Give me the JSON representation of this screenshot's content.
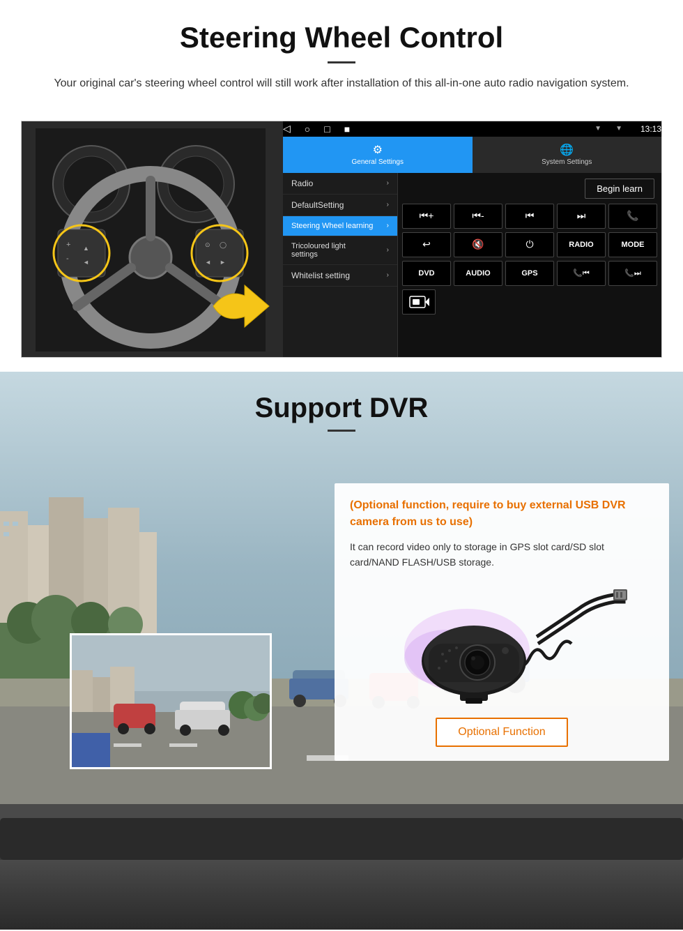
{
  "header": {
    "title": "Steering Wheel Control",
    "subtitle": "Your original car's steering wheel control will still work after installation of this all-in-one auto radio navigation system."
  },
  "android_ui": {
    "statusbar": {
      "time": "13:13",
      "icons": [
        "signal",
        "wifi",
        "battery"
      ]
    },
    "nav_icons": [
      "◁",
      "○",
      "□",
      "■"
    ],
    "tabs": [
      {
        "icon": "⚙",
        "label": "General Settings",
        "active": true
      },
      {
        "icon": "🌐",
        "label": "System Settings",
        "active": false
      }
    ],
    "menu_items": [
      {
        "label": "Radio",
        "active": false
      },
      {
        "label": "DefaultSetting",
        "active": false
      },
      {
        "label": "Steering Wheel learning",
        "active": true
      },
      {
        "label": "Tricoloured light settings",
        "active": false
      },
      {
        "label": "Whitelist setting",
        "active": false
      }
    ],
    "begin_learn_label": "Begin learn",
    "control_buttons_row1": [
      "⏮+",
      "⏮-",
      "⏮",
      "⏭",
      "📞"
    ],
    "control_buttons_row2": [
      "↩",
      "🔇",
      "⏻",
      "RADIO",
      "MODE"
    ],
    "control_buttons_row3": [
      "DVD",
      "AUDIO",
      "GPS",
      "📞⏮",
      "📞⏭"
    ],
    "dvr_icon": "📷"
  },
  "dvr_section": {
    "title": "Support DVR",
    "info_card": {
      "optional_text": "(Optional function, require to buy external USB DVR camera from us to use)",
      "desc_text": "It can record video only to storage in GPS slot card/SD slot card/NAND FLASH/USB storage."
    },
    "optional_function_btn": "Optional Function"
  }
}
